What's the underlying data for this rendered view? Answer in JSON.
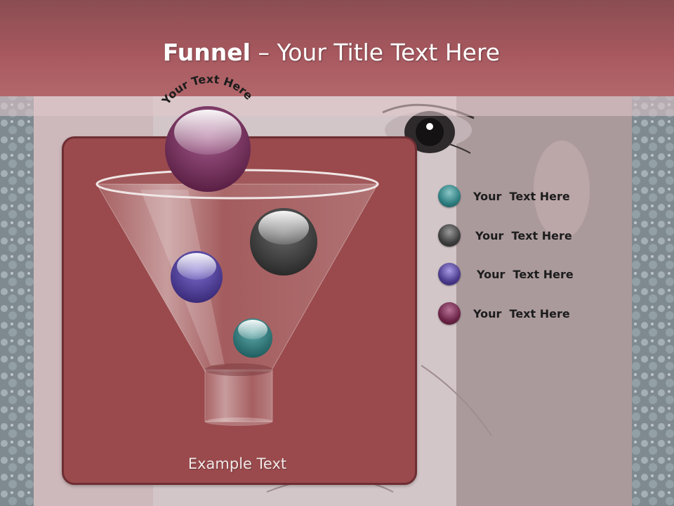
{
  "title": {
    "bold": "Funnel",
    "rest": " – Your Title Text Here"
  },
  "funnel": {
    "arc_label": "Your Text Here",
    "example_text": "Example Text"
  },
  "legend": [
    {
      "label": "Your  Text Here",
      "color": "#2c7d7f"
    },
    {
      "label": "Your  Text Here",
      "color": "#3d3d3d"
    },
    {
      "label": "Your  Text Here",
      "color": "#4b3a8c"
    },
    {
      "label": "Your  Text Here",
      "color": "#6b2446"
    }
  ],
  "colors": {
    "title_bar": "#a6585e",
    "panel": "#9a4a4c",
    "panel_border": "#6e2e33"
  }
}
